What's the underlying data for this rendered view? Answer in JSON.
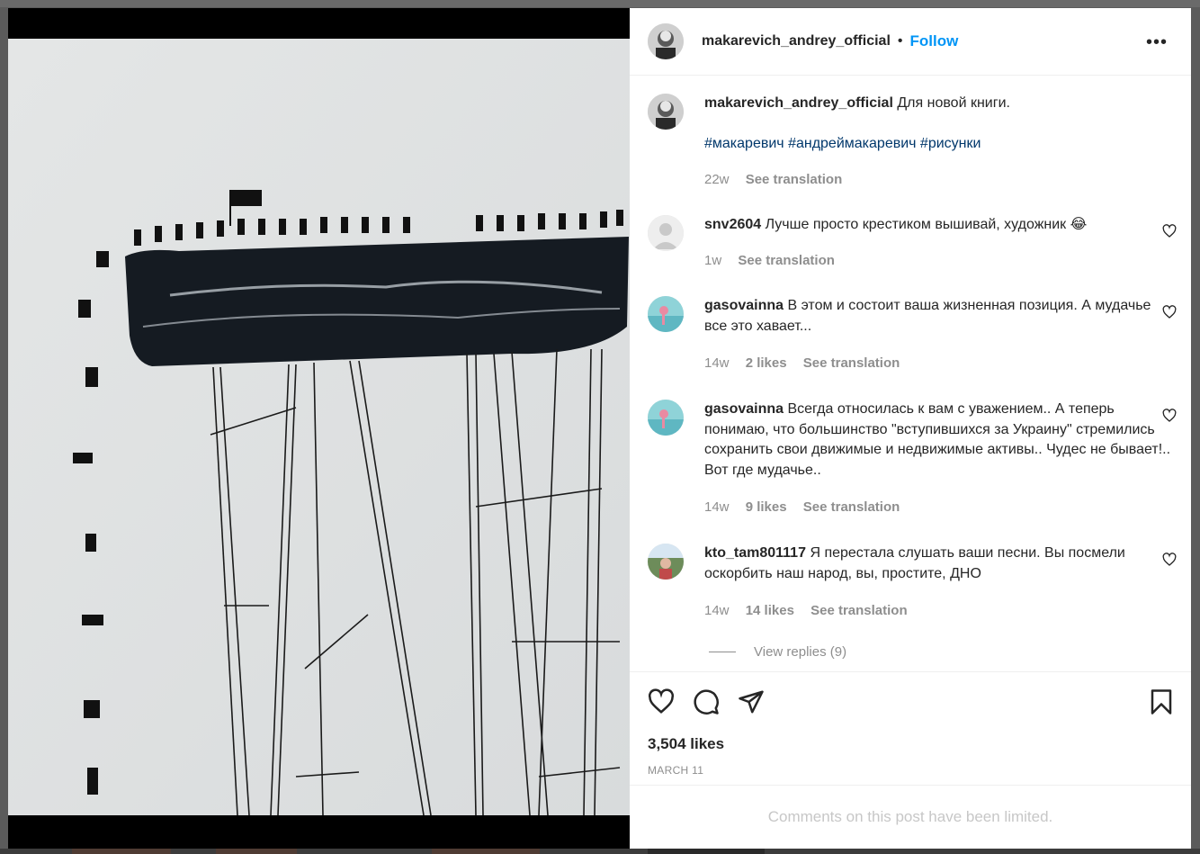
{
  "post": {
    "username": "makarevich_andrey_official",
    "follow_label": "Follow",
    "more_label": "•••",
    "caption": {
      "text": "Для новой книги.",
      "hashtags": "#макаревич #андреймакаревич #рисунки",
      "age": "22w",
      "translate_label": "See translation"
    },
    "likes": "3,504 likes",
    "date": "MARCH 11",
    "limited_notice": "Comments on this post have been limited."
  },
  "comments": [
    {
      "user": "snv2604",
      "text": "Лучше просто крестиком вышивай, художник 😂",
      "age": "1w",
      "likes": "",
      "translate_label": "See translation"
    },
    {
      "user": "gasovainna",
      "text": "В этом и состоит ваша жизненная позиция. А мудачье все это хавает...",
      "age": "14w",
      "likes": "2 likes",
      "translate_label": "See translation"
    },
    {
      "user": "gasovainna",
      "text": "Всегда относилась к вам с уважением.. А теперь понимаю, что большинство \"вступившихся за Украину\" стремились сохранить свои движимые и недвижимые активы.. Чудес не бывает!.. Вот где мудачье..",
      "age": "14w",
      "likes": "9 likes",
      "translate_label": "See translation"
    },
    {
      "user": "kto_tam801117",
      "text": "Я перестала слушать ваши песни. Вы посмели оскорбить наш народ, вы, простите, ДНО",
      "age": "14w",
      "likes": "14 likes",
      "translate_label": "See translation"
    }
  ],
  "view_replies": "View replies (9)",
  "icons": [
    "heart-icon",
    "comment-icon",
    "share-icon",
    "bookmark-icon",
    "more-icon"
  ]
}
